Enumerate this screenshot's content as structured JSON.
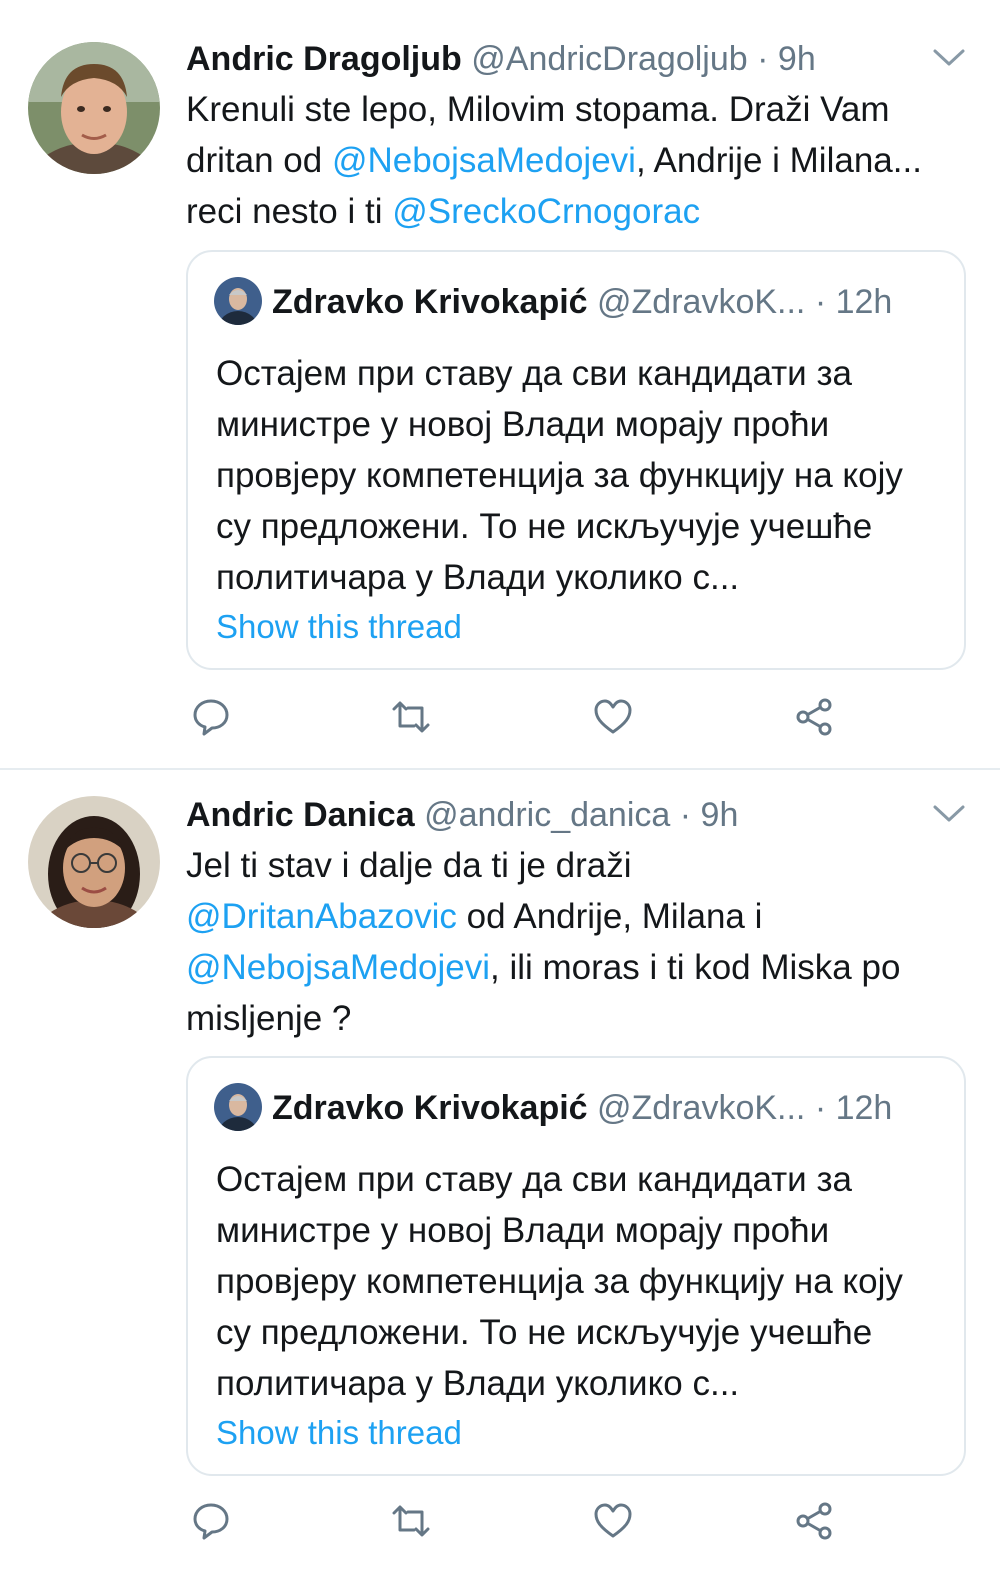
{
  "tweets": [
    {
      "author_name": "Andric Dragoljub",
      "author_handle": "@AndricDragoljub",
      "separator": "·",
      "time": "9h",
      "text": {
        "p1": "Krenuli ste lepo, Milovim stopama. Draži Vam dritan od ",
        "m1": "@NebojsaMedojevi",
        "p2": ", Andrije i Milana... reci nesto i ti ",
        "m2": "@SreckoCrnogorac"
      },
      "quote": {
        "author_name": "Zdravko Krivokapić",
        "author_handle": "@ZdravkoK...",
        "separator": "·",
        "time": "12h",
        "text": "Остајем при ставу да сви кандидати за министре у новој Влади морају проћи провјеру компетенција за функцију на коју су предложени. То не искључује учешће политичара у Влади уколико с...",
        "link": "Show this thread"
      }
    },
    {
      "author_name": "Andric Danica",
      "author_handle": "@andric_danica",
      "separator": "·",
      "time": "9h",
      "text": {
        "p1": "Jel ti stav i dalje da ti je draži ",
        "m1": "@DritanAbazovic",
        "p2": "  od Andrije, Milana i ",
        "m2": "@NebojsaMedojevi",
        "p3": ", ili moras i ti kod Miska po misljenje ?"
      },
      "quote": {
        "author_name": "Zdravko Krivokapić",
        "author_handle": "@ZdravkoK...",
        "separator": "·",
        "time": "12h",
        "text": "Остајем при ставу да сви кандидати за министре у новој Влади морају проћи провјеру компетенција за функцију на коју су предложени. То не искључује учешће политичара у Влади уколико с...",
        "link": "Show this thread"
      }
    }
  ],
  "icons": {
    "reply": "reply-icon",
    "retweet": "retweet-icon",
    "like": "like-icon",
    "share": "share-icon",
    "caret": "chevron-down-icon"
  },
  "colors": {
    "link": "#1da1f2",
    "secondary_text": "#657786",
    "icon": "#657786",
    "border": "#e1e8ed"
  }
}
